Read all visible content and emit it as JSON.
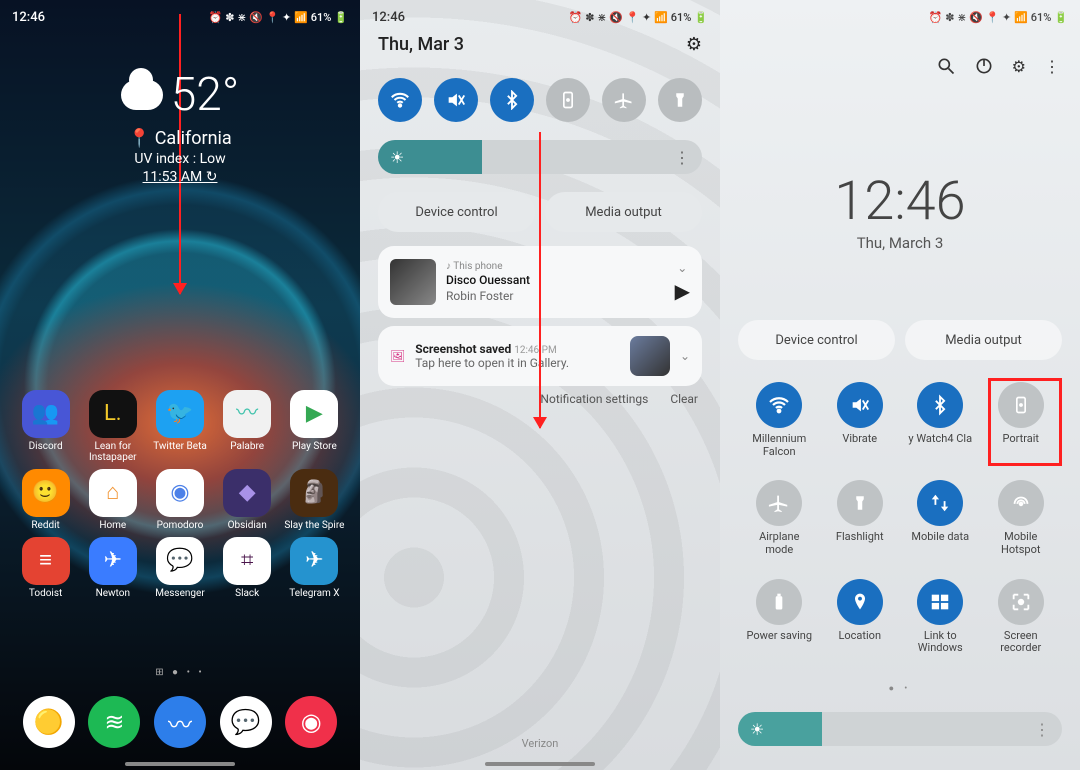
{
  "shared": {
    "clock": "12:46",
    "battery_pct": "61%",
    "status_icons": "⏰ ✽ ⋇ 🔇 📍 ✦ 📶"
  },
  "p1": {
    "weather": {
      "temp": "52°",
      "location": "California",
      "uv": "UV index : Low",
      "time": "11:53 AM ↻"
    },
    "apps": [
      {
        "name": "Discord",
        "bg": "#4856d6",
        "fg": "#fff",
        "glyph": "👥"
      },
      {
        "name": "Lean for Instapaper",
        "bg": "#111",
        "fg": "#f3c92a",
        "glyph": "L."
      },
      {
        "name": "Twitter Beta",
        "bg": "#1da1f2",
        "fg": "#fff",
        "glyph": "🐦"
      },
      {
        "name": "Palabre",
        "bg": "#f1f1f1",
        "fg": "#43c3ad",
        "glyph": "〰"
      },
      {
        "name": "Play Store",
        "bg": "#fff",
        "fg": "#34a853",
        "glyph": "▶"
      },
      {
        "name": "Reddit",
        "bg": "#ff8a00",
        "fg": "#fff",
        "glyph": "🙂"
      },
      {
        "name": "Home",
        "bg": "#fff",
        "fg": "#f19534",
        "glyph": "⌂"
      },
      {
        "name": "Pomodoro",
        "bg": "#fff",
        "fg": "#4d81e8",
        "glyph": "◉"
      },
      {
        "name": "Obsidian",
        "bg": "#3b2f6a",
        "fg": "#a892e8",
        "glyph": "◆"
      },
      {
        "name": "Slay the Spire",
        "bg": "#4a2c10",
        "fg": "#e7a23a",
        "glyph": "🗿"
      },
      {
        "name": "Todoist",
        "bg": "#e44332",
        "fg": "#fff",
        "glyph": "≡"
      },
      {
        "name": "Newton",
        "bg": "#3a7cff",
        "fg": "#fff",
        "glyph": "✈"
      },
      {
        "name": "Messenger",
        "bg": "#fff",
        "fg": "#a033ff",
        "glyph": "💬"
      },
      {
        "name": "Slack",
        "bg": "#fff",
        "fg": "#4a154b",
        "glyph": "⌗"
      },
      {
        "name": "Telegram X",
        "bg": "#2593cf",
        "fg": "#fff",
        "glyph": "✈"
      }
    ],
    "dock": [
      {
        "name": "Chrome Beta",
        "bg": "#fff",
        "glyph": "🟡"
      },
      {
        "name": "Spotify",
        "bg": "#1db954",
        "glyph": "≋"
      },
      {
        "name": "Surfshark",
        "bg": "#2d7eea",
        "glyph": "〰"
      },
      {
        "name": "Messages",
        "bg": "#fff",
        "glyph": "💬"
      },
      {
        "name": "Camera",
        "bg": "#f0304a",
        "glyph": "◉"
      }
    ]
  },
  "p2": {
    "date": "Thu, Mar 3",
    "device_control": "Device control",
    "media_output": "Media output",
    "media": {
      "source": "This phone",
      "title": "Disco Ouessant",
      "artist": "Robin Foster"
    },
    "notif": {
      "title": "Screenshot saved",
      "time": "12:46 PM",
      "sub": "Tap here to open it in Gallery."
    },
    "links_settings": "Notification settings",
    "links_clear": "Clear",
    "carrier": "Verizon"
  },
  "p3": {
    "bigtime": "12:46",
    "bigdate": "Thu, March 3",
    "device_control": "Device control",
    "media_output": "Media output",
    "tiles": [
      {
        "label": "Millennium Falcon",
        "on": true,
        "glyph": "wifi"
      },
      {
        "label": "Vibrate",
        "on": true,
        "glyph": "mute"
      },
      {
        "label": "y Watch4 Cla",
        "on": true,
        "glyph": "bt"
      },
      {
        "label": "Portrait",
        "on": false,
        "glyph": "portrait"
      },
      {
        "label": "Airplane mode",
        "on": false,
        "glyph": "plane"
      },
      {
        "label": "Flashlight",
        "on": false,
        "glyph": "torch"
      },
      {
        "label": "Mobile data",
        "on": true,
        "glyph": "data"
      },
      {
        "label": "Mobile Hotspot",
        "on": false,
        "glyph": "hotspot"
      },
      {
        "label": "Power saving",
        "on": false,
        "glyph": "battery"
      },
      {
        "label": "Location",
        "on": true,
        "glyph": "pin"
      },
      {
        "label": "Link to Windows",
        "on": true,
        "glyph": "windows"
      },
      {
        "label": "Screen recorder",
        "on": false,
        "glyph": "record"
      }
    ]
  }
}
